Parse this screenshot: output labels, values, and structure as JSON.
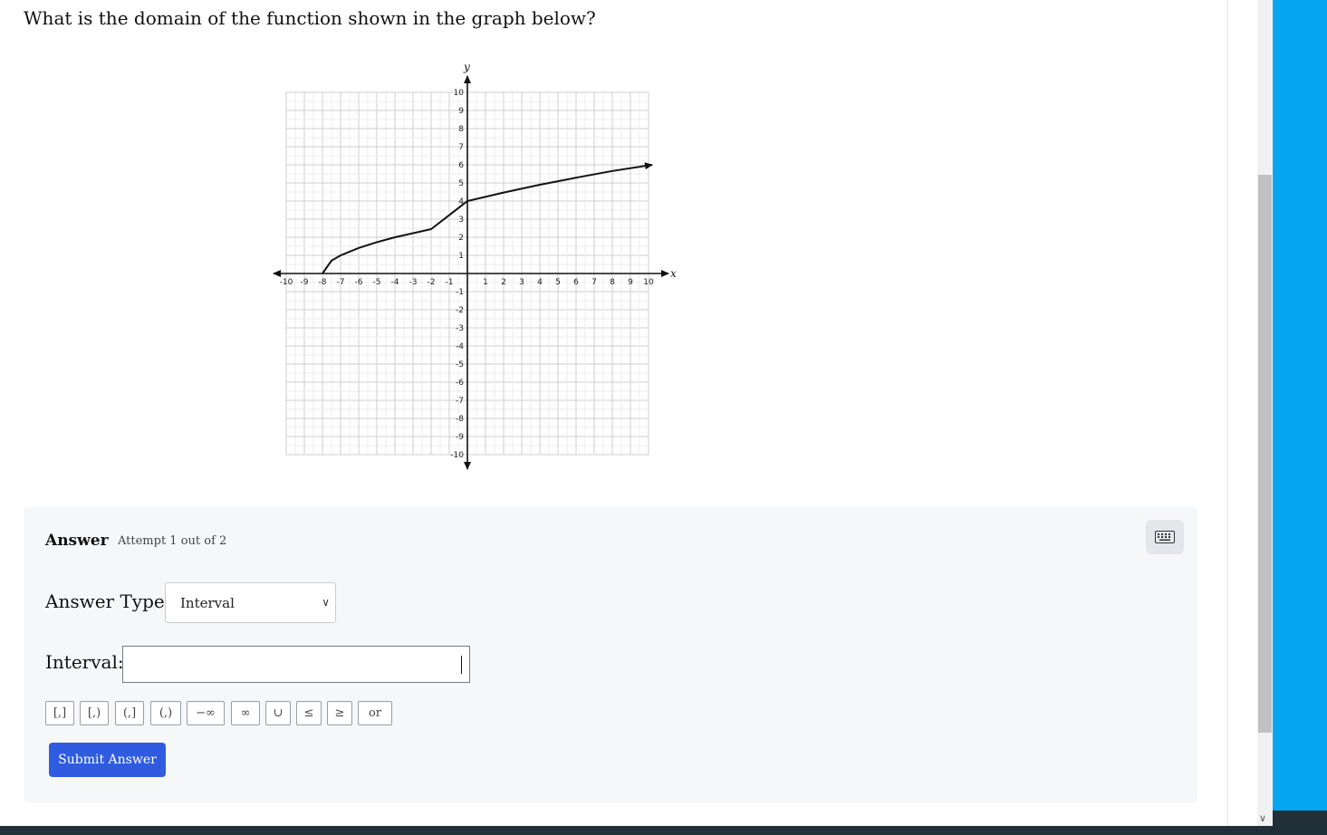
{
  "question": "What is the domain of the function shown in the graph below?",
  "chart_data": {
    "type": "line",
    "xlabel": "x",
    "ylabel": "y",
    "xlim": [
      -10,
      10
    ],
    "ylim": [
      -10,
      10
    ],
    "grid": true,
    "x_ticks": [
      "-10",
      "-9",
      "-8",
      "-7",
      "-6",
      "-5",
      "-4",
      "-3",
      "-2",
      "-1",
      "1",
      "2",
      "3",
      "4",
      "5",
      "6",
      "7",
      "8",
      "9",
      "10"
    ],
    "y_ticks": [
      "10",
      "9",
      "8",
      "7",
      "6",
      "5",
      "4",
      "3",
      "2",
      "1",
      "-1",
      "-2",
      "-3",
      "-4",
      "-5",
      "-6",
      "-7",
      "-8",
      "-9",
      "-10"
    ],
    "series": [
      {
        "x": [
          -8,
          -7.5,
          -7,
          -6,
          -5,
          -4,
          -2,
          0,
          2,
          4,
          6,
          8,
          10.2
        ],
        "y": [
          0,
          0.71,
          1.0,
          1.41,
          1.73,
          2.0,
          2.45,
          4.0,
          4.47,
          4.9,
          5.29,
          5.66,
          6.0
        ],
        "endpoint": "closed-left",
        "arrow": "right"
      }
    ]
  },
  "answer": {
    "title": "Answer",
    "attempt": "Attempt 1 out of 2",
    "answer_type_label": "Answer Type:",
    "answer_type_value": "Interval",
    "interval_label": "Interval:",
    "interval_value": "",
    "symbols": [
      "[,]",
      "[,)",
      "(,]",
      "(,)",
      "−∞",
      "∞",
      "∪",
      "≤",
      "≥",
      "or"
    ],
    "submit_label": "Submit Answer",
    "keyboard_icon": "keyboard-icon"
  },
  "colors": {
    "submit": "#2f5be0",
    "panel": "#f6f7f9",
    "side_strip": "#05a6ef"
  }
}
